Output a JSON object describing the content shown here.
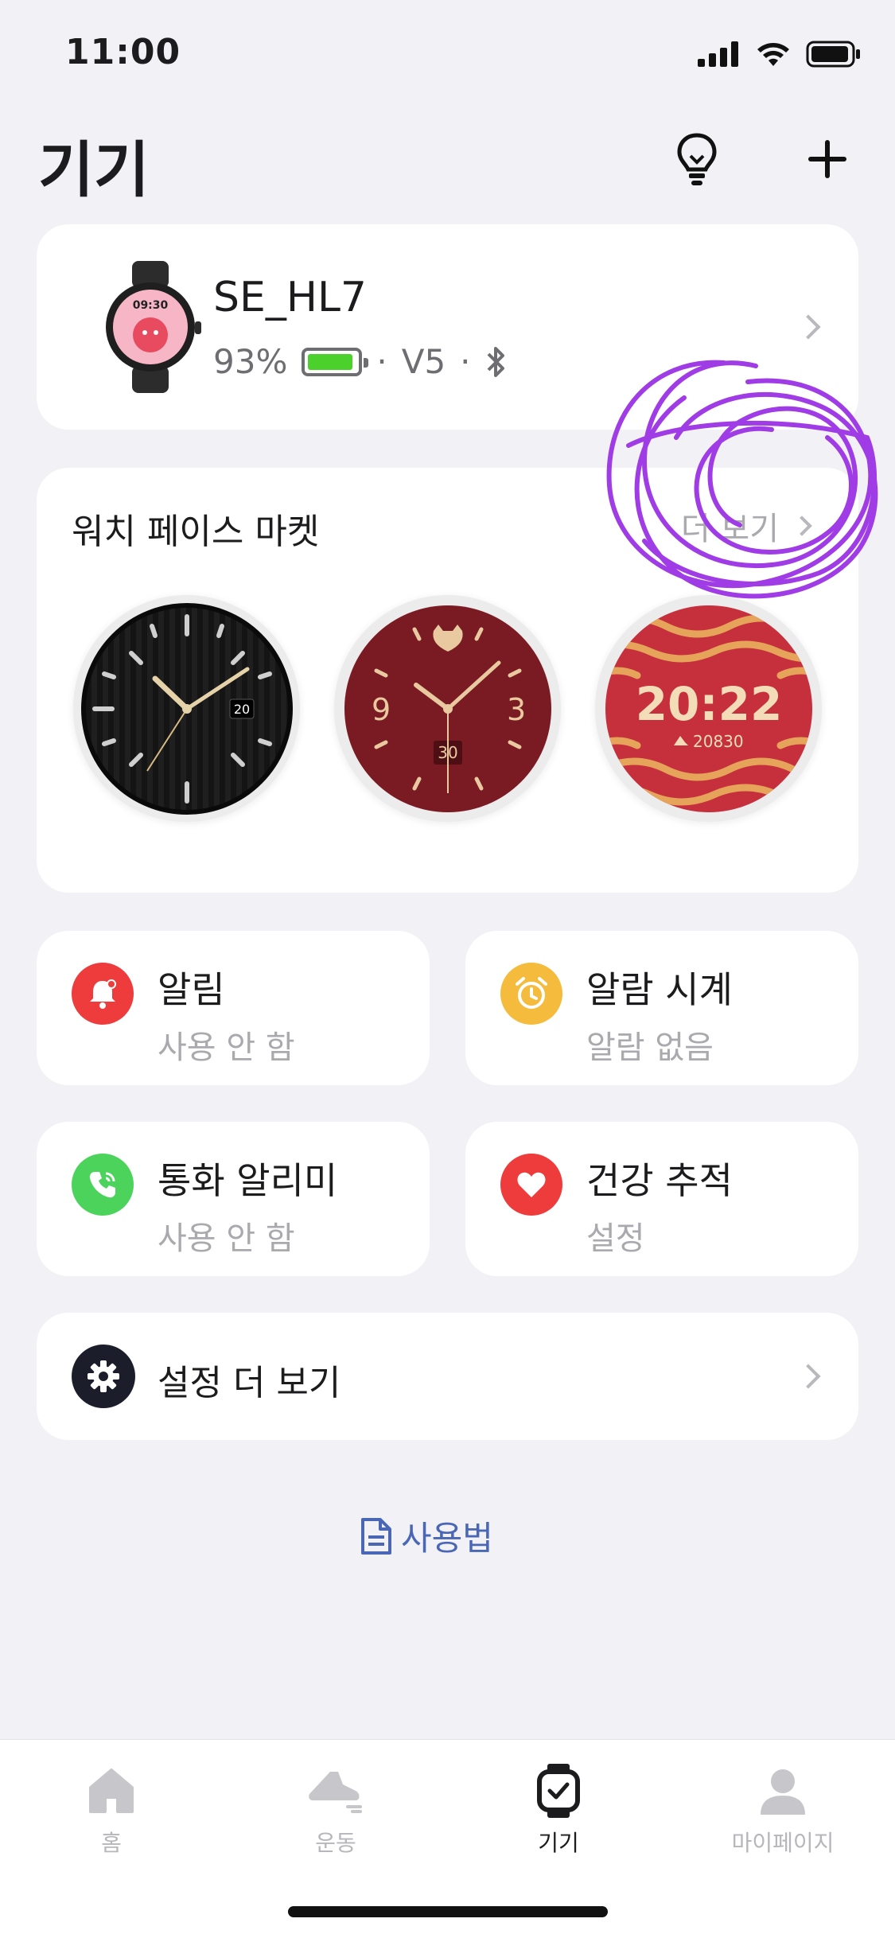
{
  "status_bar": {
    "time": "11:00"
  },
  "header": {
    "title": "기기",
    "tip_icon": "lightbulb-icon",
    "add_icon": "plus-icon"
  },
  "device": {
    "name": "SE_HL7",
    "battery_percent": "93%",
    "battery_level": 0.93,
    "separator": "·",
    "version": "V5",
    "bluetooth_icon": "bluetooth-icon",
    "watch_screen_time": "09:30"
  },
  "market": {
    "title": "워치 페이스 마켓",
    "more_label": "더 보기",
    "faces": [
      {
        "name": "black-analog",
        "date": "20"
      },
      {
        "name": "tiger-red-analog",
        "date": "30",
        "numerals": [
          "9",
          "3"
        ]
      },
      {
        "name": "tiger-stripe-digital",
        "time": "20:22",
        "steps": "20830"
      }
    ]
  },
  "tiles": [
    {
      "title": "알림",
      "subtitle": "사용 안 함",
      "icon": "bell-icon",
      "color": "#ee3b3b"
    },
    {
      "title": "알람 시계",
      "subtitle": "알람 없음",
      "icon": "alarm-clock-icon",
      "color": "#f5bb3c"
    },
    {
      "title": "통화 알리미",
      "subtitle": "사용 안 함",
      "icon": "phone-icon",
      "color": "#4cd35b"
    },
    {
      "title": "건강 추적",
      "subtitle": "설정",
      "icon": "heart-icon",
      "color": "#ee3b3b"
    }
  ],
  "settings": {
    "label": "설정 더 보기",
    "icon": "gear-icon"
  },
  "guide": {
    "label": "사용법",
    "icon": "document-icon"
  },
  "nav": [
    {
      "label": "홈",
      "icon": "home-icon"
    },
    {
      "label": "운동",
      "icon": "running-shoe-icon"
    },
    {
      "label": "기기",
      "icon": "watch-icon",
      "active": true
    },
    {
      "label": "마이페이지",
      "icon": "person-icon"
    }
  ],
  "colors": {
    "background": "#f1f1f6",
    "link": "#4a67b5",
    "annotation": "#a03ce6"
  }
}
